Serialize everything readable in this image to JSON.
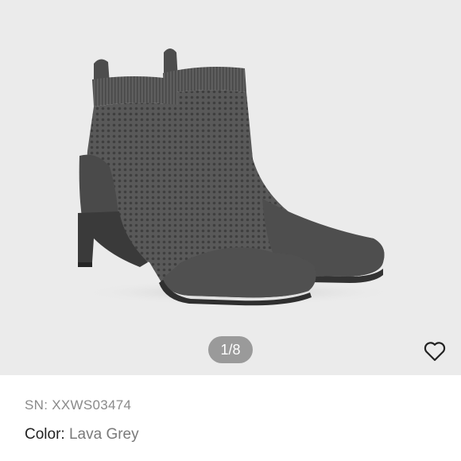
{
  "gallery": {
    "counter": "1/8",
    "product_image": "knit-sock-ankle-boots-photo",
    "favorite_icon": "heart-outline-icon"
  },
  "product": {
    "sn_label": "SN:",
    "sn_value": "XXWS03474",
    "color_label": "Color:",
    "color_value": "Lava Grey"
  },
  "colors": {
    "gallery_bg": "#ebebeb",
    "counter_bg": "#9a9a9a",
    "boot_knit": "#5a5a5a",
    "text_primary": "#222222",
    "text_muted": "#8a8a8a"
  }
}
